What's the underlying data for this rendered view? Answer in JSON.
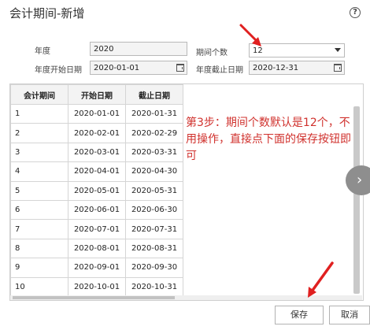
{
  "dialog": {
    "title": "会计期间-新增",
    "help_icon": "question-icon"
  },
  "form": {
    "year_label": "年度",
    "year_value": "2020",
    "period_count_label": "期间个数",
    "period_count_value": "12",
    "start_date_label": "年度开始日期",
    "start_date_value": "2020-01-01",
    "end_date_label": "年度截止日期",
    "end_date_value": "2020-12-31"
  },
  "table": {
    "headers": [
      "会计期间",
      "开始日期",
      "截止日期"
    ],
    "rows": [
      [
        "1",
        "2020-01-01",
        "2020-01-31"
      ],
      [
        "2",
        "2020-02-01",
        "2020-02-29"
      ],
      [
        "3",
        "2020-03-01",
        "2020-03-31"
      ],
      [
        "4",
        "2020-04-01",
        "2020-04-30"
      ],
      [
        "5",
        "2020-05-01",
        "2020-05-31"
      ],
      [
        "6",
        "2020-06-01",
        "2020-06-30"
      ],
      [
        "7",
        "2020-07-01",
        "2020-07-31"
      ],
      [
        "8",
        "2020-08-01",
        "2020-08-31"
      ],
      [
        "9",
        "2020-09-01",
        "2020-09-30"
      ],
      [
        "10",
        "2020-10-01",
        "2020-10-31"
      ]
    ]
  },
  "annotation": {
    "text": "第3步：期间个数默认是12个，不用操作，直接点下面的保存按钮即可",
    "color": "#d0312d"
  },
  "buttons": {
    "save_label": "保存",
    "cancel_label": "取消"
  },
  "colors": {
    "arrow": "#e02020",
    "annotation_text": "#d0312d"
  }
}
